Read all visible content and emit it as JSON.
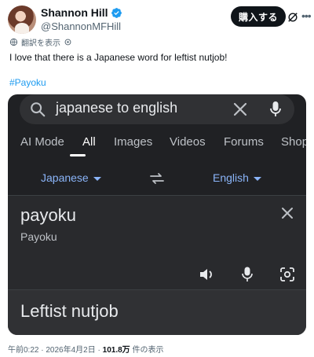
{
  "author": {
    "name": "Shannon Hill",
    "handle": "@ShannonMFHill"
  },
  "actions": {
    "buy_label": "購入する",
    "icons": [
      "verified-badge-icon",
      "grok-icon",
      "more-icon"
    ]
  },
  "translate_link": "翻訳を表示",
  "tweet": {
    "text": "I love that there is a Japanese word for leftist nutjob!",
    "hashtag": "#Payoku"
  },
  "screenshot": {
    "search_query": "japanese to english",
    "tabs": [
      {
        "label": "AI Mode",
        "active": false
      },
      {
        "label": "All",
        "active": true
      },
      {
        "label": "Images",
        "active": false
      },
      {
        "label": "Videos",
        "active": false
      },
      {
        "label": "Forums",
        "active": false
      },
      {
        "label": "Shop",
        "active": false
      }
    ],
    "source_lang": "Japanese",
    "target_lang": "English",
    "source_text": "payoku",
    "source_transliteration": "Payoku",
    "translation": "Leftist nutjob",
    "colors": {
      "background": "#202124",
      "accent": "#8ab4f8",
      "text": "#e8eaed"
    }
  },
  "meta": {
    "time": "午前0:22",
    "separator": "·",
    "date": "2026年4月2日",
    "views_count": "101.8万",
    "views_suffix": "件の表示"
  }
}
